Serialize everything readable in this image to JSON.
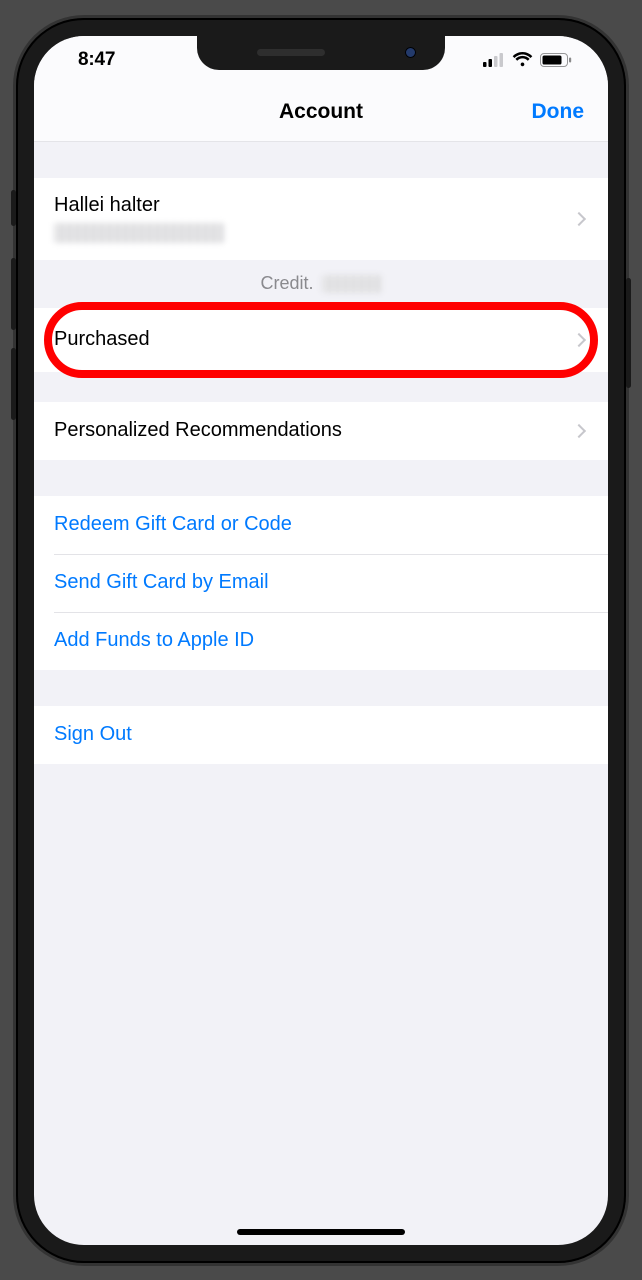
{
  "status": {
    "time": "8:47"
  },
  "nav": {
    "title": "Account",
    "done": "Done"
  },
  "profile": {
    "name": "Hallei halter"
  },
  "credit": {
    "label": "Credit."
  },
  "rows": {
    "purchased": "Purchased",
    "recommendations": "Personalized Recommendations",
    "redeem": "Redeem Gift Card or Code",
    "sendGift": "Send Gift Card by Email",
    "addFunds": "Add Funds to Apple ID",
    "signOut": "Sign Out"
  },
  "annotation": {
    "highlightedRow": "purchased"
  }
}
